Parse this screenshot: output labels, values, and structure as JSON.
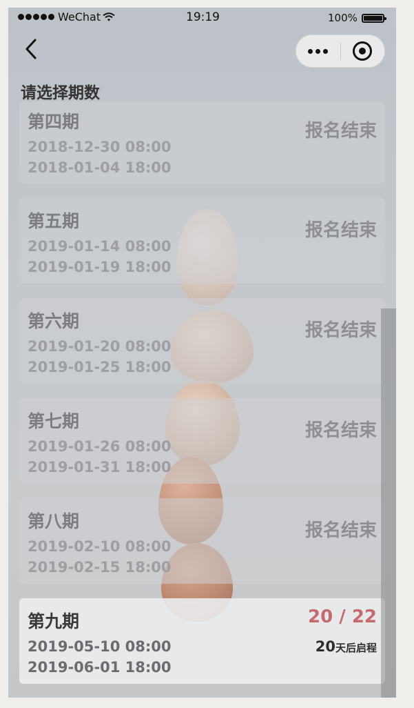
{
  "status_bar": {
    "carrier": "WeChat",
    "time": "19:19",
    "battery": "100%"
  },
  "nav": {
    "back_icon": "chevron-left-icon",
    "more_icon": "more-dots-icon",
    "close_icon": "target-circle-icon"
  },
  "page": {
    "title": "请选择期数"
  },
  "periods": [
    {
      "name": "第四期",
      "start": "2018-12-30 08:00",
      "end": "2018-01-04 18:00",
      "status": "报名结束"
    },
    {
      "name": "第五期",
      "start": "2019-01-14 08:00",
      "end": "2019-01-19 18:00",
      "status": "报名结束"
    },
    {
      "name": "第六期",
      "start": "2019-01-20 08:00",
      "end": "2019-01-25 18:00",
      "status": "报名结束"
    },
    {
      "name": "第七期",
      "start": "2019-01-26 08:00",
      "end": "2019-01-31 18:00",
      "status": "报名结束"
    },
    {
      "name": "第八期",
      "start": "2019-02-10 08:00",
      "end": "2019-02-15 18:00",
      "status": "报名结束"
    },
    {
      "name": "第九期",
      "start": "2019-05-10 08:00",
      "end": "2019-06-01 18:00",
      "status": "20 / 22",
      "countdown_num": "20",
      "countdown_text": "天后启程"
    }
  ],
  "colors": {
    "accent": "#c56a6e",
    "ended_text": "#8e8f93"
  }
}
